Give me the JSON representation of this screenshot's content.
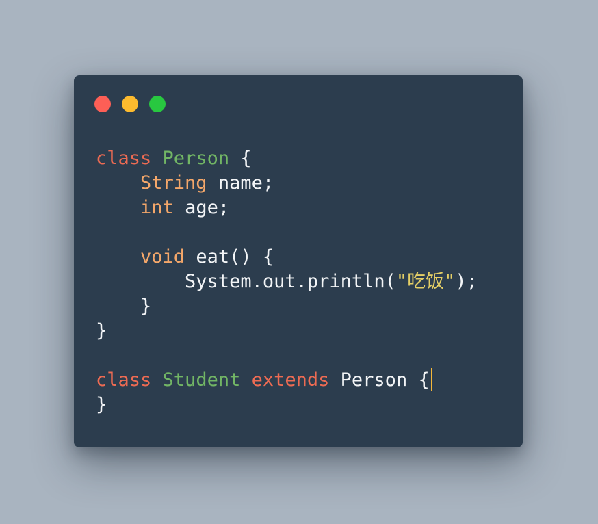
{
  "colors": {
    "window_bg": "#2c3d4e",
    "page_bg": "#a9b4c0",
    "keyword": "#ed6b53",
    "class_name": "#72b665",
    "type": "#f4a76a",
    "plain": "#f3f5f7",
    "string": "#e5cf66",
    "caret": "#f4b73a",
    "close": "#fd5f56",
    "minimize": "#fdbb2e",
    "zoom": "#28c840"
  },
  "window_controls": [
    {
      "name": "close-button",
      "color": "#fd5f56"
    },
    {
      "name": "minimize-button",
      "color": "#fdbb2e"
    },
    {
      "name": "zoom-button",
      "color": "#28c840"
    }
  ],
  "editor": {
    "lines": [
      [
        {
          "text": "class",
          "kind": "keyword"
        },
        {
          "text": " ",
          "kind": "plain"
        },
        {
          "text": "Person",
          "kind": "class_name"
        },
        {
          "text": " {",
          "kind": "plain"
        }
      ],
      [
        {
          "text": "    ",
          "kind": "plain"
        },
        {
          "text": "String",
          "kind": "type"
        },
        {
          "text": " name;",
          "kind": "plain"
        }
      ],
      [
        {
          "text": "    ",
          "kind": "plain"
        },
        {
          "text": "int",
          "kind": "type"
        },
        {
          "text": " age;",
          "kind": "plain"
        }
      ],
      [],
      [
        {
          "text": "    ",
          "kind": "plain"
        },
        {
          "text": "void",
          "kind": "type"
        },
        {
          "text": " eat() {",
          "kind": "plain"
        }
      ],
      [
        {
          "text": "        System.out.println(",
          "kind": "plain"
        },
        {
          "text": "\"吃饭\"",
          "kind": "string"
        },
        {
          "text": ");",
          "kind": "plain"
        }
      ],
      [
        {
          "text": "    }",
          "kind": "plain"
        }
      ],
      [
        {
          "text": "}",
          "kind": "plain"
        }
      ],
      [],
      [
        {
          "text": "class",
          "kind": "keyword"
        },
        {
          "text": " ",
          "kind": "plain"
        },
        {
          "text": "Student",
          "kind": "class_name"
        },
        {
          "text": " ",
          "kind": "plain"
        },
        {
          "text": "extends",
          "kind": "keyword"
        },
        {
          "text": " Person {",
          "kind": "plain"
        }
      ],
      [
        {
          "text": "}",
          "kind": "plain"
        }
      ]
    ],
    "caret_line": 9
  }
}
